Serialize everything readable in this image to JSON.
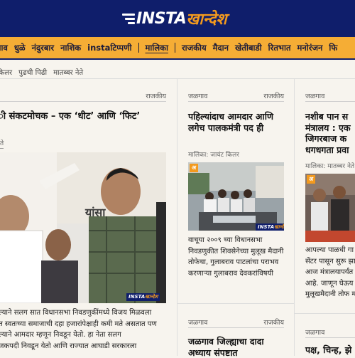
{
  "header": {
    "logo_prefix": "INSTA",
    "logo_suffix": "खान्देश"
  },
  "nav": {
    "items": [
      "गाव",
      "धुळे",
      "नंदुरबार",
      "नाशिक",
      "instaटिप्पणी",
      "मालिका",
      "राजकीय",
      "मैदान",
      "खेतीबाडी",
      "रितभात",
      "मनोरंजन",
      "फि"
    ],
    "active_index": 5
  },
  "subnav": {
    "items": [
      "किलर",
      "पुढची पिढी",
      "मातब्बर नेते"
    ]
  },
  "colors": {
    "header_bg": "#0f1e6b",
    "nav_bg": "#f5ad35",
    "accent_orange": "#f39a1e",
    "page_bg": "#f7f4ee"
  },
  "main_article": {
    "category": "राजकीय",
    "headline": "ी संकटमोचक – एक ‘धीट’ आणि ‘फिट’",
    "byline_fragment": "ते",
    "watermark": "INSTAखान्देश",
    "body_lines": [
      "ल्याने सलग सात विधानसभा निवडणुकींमध्ये विजय मिळवला",
      "त स्वतःच्या समाजाची दहा हजारांपेक्षाही कमी मते असतात पण",
      "ल्याने आमदार म्हणून निवडून येतो. हा नेता सलग",
      "जकपदी निवडून येतो आणि राज्यात आघाडी सरकारला"
    ]
  },
  "mid_article_1": {
    "location": "जळगाव",
    "category": "राजकीय",
    "headline": "पहिल्यांदाच आमदार आणि लगेच पालकमंत्री पद ही",
    "byline": "मालिका: जायंट किलर",
    "badge": "अ",
    "body": "वाचूया २००९ च्या विधानसभा निवडणुकीत शिवसेनेच्या मुलूख मैदानी तोफेचा, गुलाबराव पाटलांचा पराभव करणाऱ्या गुलाबराव देवकरांविषयी"
  },
  "mid_article_2": {
    "location": "जळगाव",
    "category": "राजकीय",
    "headline": "जळगाव जिल्ह्याचा दादा अध्याय संपष्टात"
  },
  "right_article_1": {
    "location": "जळगाव",
    "headline": "नशीब पान स मंत्रालय : एक जिगरबाज क धगधगता प्रवा",
    "byline": "मालिका: मातब्बर नेते",
    "badge": "अ",
    "body_lines": [
      "आपल्या पाळधी गा",
      "सेंटर पासून सुरू झा",
      "आज मंत्रालयापर्यंत",
      "आहे. जाणून घेऊय",
      "मुलूखमैदानी तोफ म"
    ]
  },
  "right_article_2": {
    "location": "जळगाव",
    "headline": "पक्ष, चिन्ह, झे"
  }
}
